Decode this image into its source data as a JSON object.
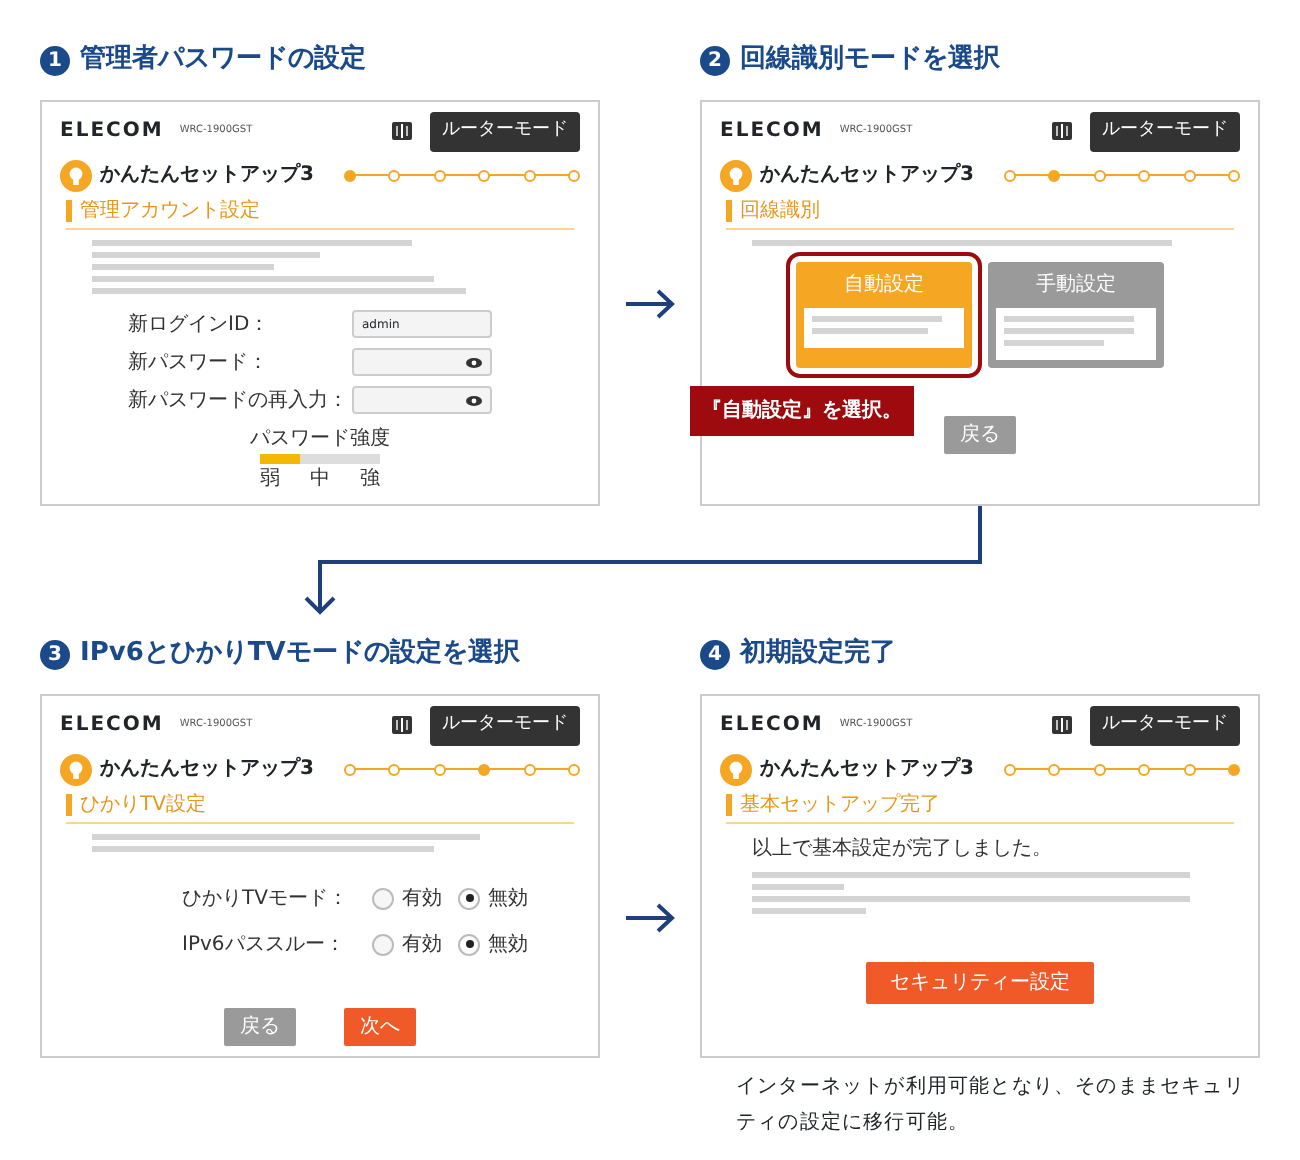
{
  "sections": [
    {
      "number": "1",
      "title": "管理者パスワードの設定",
      "screen": {
        "logo": "ELECOM",
        "model": "WRC-1900GST",
        "mode_tab": "ルーターモード",
        "app_title": "かんたんセットアップ3",
        "steps": [
          {
            "selected": true
          },
          {
            "selected": false
          },
          {
            "selected": false
          },
          {
            "selected": false
          },
          {
            "selected": false
          },
          {
            "selected": false
          }
        ],
        "section": "管理アカウント設定",
        "kind": "password",
        "fields": [
          {
            "label": "新ログインID：",
            "value": "admin",
            "reveal": false
          },
          {
            "label": "新パスワード：",
            "reveal": true
          },
          {
            "label": "新パスワードの再入力：",
            "reveal": true
          }
        ],
        "strength": {
          "label": "パスワード強度",
          "level": 0.33,
          "marks": [
            "弱",
            "中",
            "強"
          ]
        }
      }
    },
    {
      "number": "2",
      "title": "回線識別モードを選択",
      "screen": {
        "logo": "ELECOM",
        "model": "WRC-1900GST",
        "mode_tab": "ルーターモード",
        "app_title": "かんたんセットアップ3",
        "steps": [
          {
            "selected": false
          },
          {
            "selected": true
          },
          {
            "selected": false
          },
          {
            "selected": false
          },
          {
            "selected": false
          },
          {
            "selected": false
          }
        ],
        "section": "回線識別",
        "kind": "line_mode",
        "options": [
          {
            "title": "自動設定",
            "selected": true
          },
          {
            "title": "手動設定",
            "selected": false
          }
        ],
        "callout": "『自動設定』を選択。",
        "buttons": [
          {
            "text": "戻る",
            "kind": "back"
          }
        ]
      }
    },
    {
      "number": "3",
      "title": "IPv6とひかりTVモードの設定を選択",
      "screen": {
        "logo": "ELECOM",
        "model": "WRC-1900GST",
        "mode_tab": "ルーターモード",
        "app_title": "かんたんセットアップ3",
        "steps": [
          {
            "selected": false
          },
          {
            "selected": false
          },
          {
            "selected": false
          },
          {
            "selected": true
          },
          {
            "selected": false
          },
          {
            "selected": false
          }
        ],
        "section": "ひかりTV設定",
        "kind": "tv",
        "radios": [
          {
            "label": "ひかりTVモード：",
            "options": [
              {
                "text": "有効",
                "selected": false
              },
              {
                "text": "無効",
                "selected": true
              }
            ]
          },
          {
            "label": "IPv6パススルー：",
            "options": [
              {
                "text": "有効",
                "selected": false
              },
              {
                "text": "無効",
                "selected": true
              }
            ]
          }
        ],
        "buttons": [
          {
            "text": "戻る",
            "kind": "back"
          },
          {
            "text": "次へ",
            "kind": "next"
          }
        ]
      }
    },
    {
      "number": "4",
      "title": "初期設定完了",
      "screen": {
        "logo": "ELECOM",
        "model": "WRC-1900GST",
        "mode_tab": "ルーターモード",
        "app_title": "かんたんセットアップ3",
        "steps": [
          {
            "selected": false
          },
          {
            "selected": false
          },
          {
            "selected": false
          },
          {
            "selected": false
          },
          {
            "selected": false
          },
          {
            "selected": true
          }
        ],
        "section": "基本セットアップ完了",
        "kind": "complete",
        "message": "以上で基本設定が完了しました。",
        "buttons": [
          {
            "text": "セキュリティー設定",
            "kind": "next"
          }
        ]
      }
    }
  ],
  "caption": "インターネットが利用可能となり、そのままセキュリティの設定に移行可能。"
}
